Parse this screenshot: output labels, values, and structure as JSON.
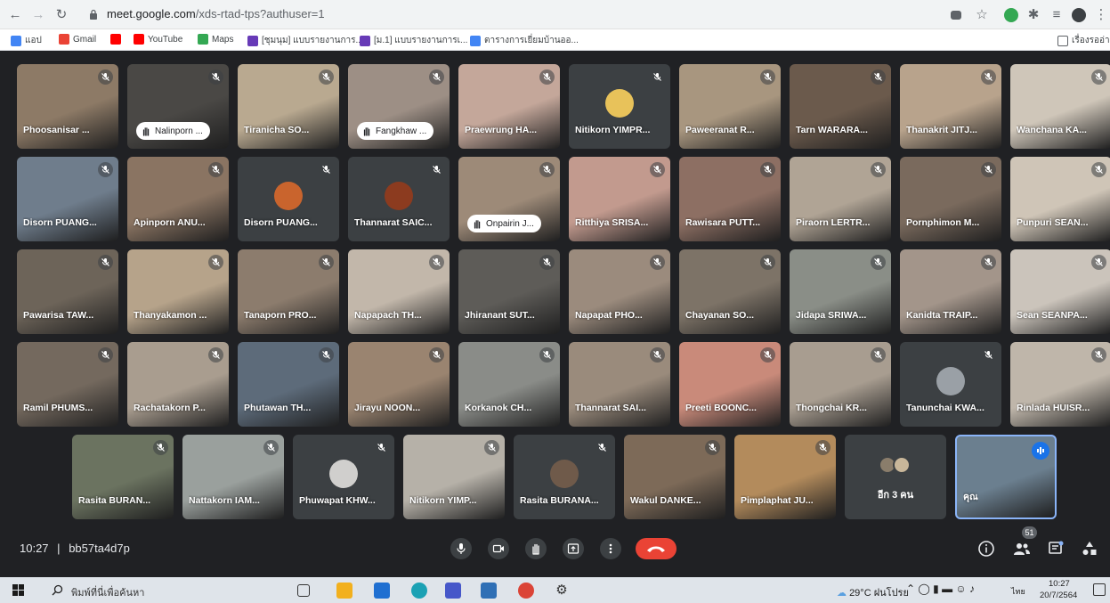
{
  "browser": {
    "url_host": "meet.google.com",
    "url_path": "/xds-rtad-tps?authuser=1",
    "bookmarks": [
      {
        "label": "แอป",
        "color": "#4285f4"
      },
      {
        "label": "Gmail",
        "color": "#ea4335"
      },
      {
        "label": "",
        "color": "#ff0000"
      },
      {
        "label": "YouTube",
        "color": "#ff0000"
      },
      {
        "label": "Maps",
        "color": "#34a853"
      },
      {
        "label": "[ชุมนุม] แบบรายงานการ...",
        "color": "#673ab7"
      },
      {
        "label": "[ม.1] แบบรายงานการเ...",
        "color": "#673ab7"
      },
      {
        "label": "ตารางการเยี่ยมบ้านออ...",
        "color": "#4285f4"
      }
    ],
    "reading_list": "เรื่องรออ่าน"
  },
  "participants": [
    {
      "name": "Phoosanisar ...",
      "bg": "#8d7a66",
      "type": "video"
    },
    {
      "name": "Nalinporn ...",
      "bg": "#4a4845",
      "type": "video",
      "hand": true
    },
    {
      "name": "Tiranicha SO...",
      "bg": "#b9a990",
      "type": "video"
    },
    {
      "name": "Fangkhaw ...",
      "bg": "#9d8f85",
      "type": "video",
      "hand": true
    },
    {
      "name": "Praewrung HA...",
      "bg": "#c4a79a",
      "type": "video"
    },
    {
      "name": "Nitikorn YIMPR...",
      "bg": "#3c4043",
      "type": "avatar",
      "avatar_color": "#e8c25a"
    },
    {
      "name": "Paweeranat R...",
      "bg": "#a8967f",
      "type": "video"
    },
    {
      "name": "Tarn WARARA...",
      "bg": "#6b5a4c",
      "type": "video"
    },
    {
      "name": "Thanakrit JITJ...",
      "bg": "#b8a38c",
      "type": "video"
    },
    {
      "name": "Wanchana KA...",
      "bg": "#cfc6b9",
      "type": "video"
    },
    {
      "name": "Disorn PUANG...",
      "bg": "#6f7d8c",
      "type": "video"
    },
    {
      "name": "Apinporn ANU...",
      "bg": "#8a7462",
      "type": "video"
    },
    {
      "name": "Disorn PUANG...",
      "bg": "#3c4043",
      "type": "avatar",
      "avatar_color": "#c9642d"
    },
    {
      "name": "Thannarat SAIC...",
      "bg": "#3c4043",
      "type": "avatar",
      "avatar_color": "#8c3b1f"
    },
    {
      "name": "Onpairin J...",
      "bg": "#9d8a78",
      "type": "video",
      "hand": true
    },
    {
      "name": "Ritthiya SRISA...",
      "bg": "#c29a8e",
      "type": "video"
    },
    {
      "name": "Rawisara PUTT...",
      "bg": "#8d6f63",
      "type": "video"
    },
    {
      "name": "Piraorn LERTR...",
      "bg": "#b0a495",
      "type": "video"
    },
    {
      "name": "Pornphimon M...",
      "bg": "#7a6a5d",
      "type": "video"
    },
    {
      "name": "Punpuri SEAN...",
      "bg": "#cfc5b7",
      "type": "video"
    },
    {
      "name": "Pawarisa TAW...",
      "bg": "#6d6459",
      "type": "video"
    },
    {
      "name": "Thanyakamon ...",
      "bg": "#b6a38a",
      "type": "video"
    },
    {
      "name": "Tanaporn PRO...",
      "bg": "#8c7c6d",
      "type": "video"
    },
    {
      "name": "Napapach TH...",
      "bg": "#c2b7aa",
      "type": "video"
    },
    {
      "name": "Jhiranant SUT...",
      "bg": "#5e5c58",
      "type": "video"
    },
    {
      "name": "Napapat PHO...",
      "bg": "#9b8b7d",
      "type": "video"
    },
    {
      "name": "Chayanan SO...",
      "bg": "#7d7367",
      "type": "video"
    },
    {
      "name": "Jidapa SRIWA...",
      "bg": "#8a8e87",
      "type": "video"
    },
    {
      "name": "Kanidta TRAIP...",
      "bg": "#a3958a",
      "type": "video"
    },
    {
      "name": "Sean SEANPA...",
      "bg": "#cbc4bb",
      "type": "video"
    },
    {
      "name": "Ramil PHUMS...",
      "bg": "#74695e",
      "type": "video"
    },
    {
      "name": "Rachatakorn P...",
      "bg": "#a99d8f",
      "type": "video"
    },
    {
      "name": "Phutawan TH...",
      "bg": "#5d6b7a",
      "type": "video"
    },
    {
      "name": "Jirayu NOON...",
      "bg": "#9a8470",
      "type": "video"
    },
    {
      "name": "Korkanok CH...",
      "bg": "#8a8c88",
      "type": "video"
    },
    {
      "name": "Thannarat SAI...",
      "bg": "#9a8b7c",
      "type": "video"
    },
    {
      "name": "Preeti BOONC...",
      "bg": "#c98a7a",
      "type": "video"
    },
    {
      "name": "Thongchai KR...",
      "bg": "#a89d90",
      "type": "video"
    },
    {
      "name": "Tanunchai KWA...",
      "bg": "#3c4043",
      "type": "avatar",
      "avatar_color": "#9aa0a6"
    },
    {
      "name": "Rinlada HUISR...",
      "bg": "#bfb6aa",
      "type": "video"
    },
    {
      "name": "Rasita BURAN...",
      "bg": "#6b7360",
      "type": "video"
    },
    {
      "name": "Nattakorn IAM...",
      "bg": "#9aa09d",
      "type": "video"
    },
    {
      "name": "Phuwapat KHW...",
      "bg": "#3c4043",
      "type": "avatar",
      "avatar_color": "#d0cfcd"
    },
    {
      "name": "Nitikorn YIMP...",
      "bg": "#b6b1a8",
      "type": "video"
    },
    {
      "name": "Rasita BURANA...",
      "bg": "#3c4043",
      "type": "avatar",
      "avatar_color": "#6f5a4a"
    },
    {
      "name": "Wakul DANKE...",
      "bg": "#7d6a58",
      "type": "video"
    },
    {
      "name": "Pimplaphat JU...",
      "bg": "#b38b5c",
      "type": "video"
    },
    {
      "name": "",
      "bg": "#3c4043",
      "type": "more",
      "more_label": "อีก 3 คน"
    },
    {
      "name": "คุณ",
      "bg": "#6b7f8f",
      "type": "self"
    }
  ],
  "meeting": {
    "time": "10:27",
    "separator": "|",
    "code": "bb57ta4d7p",
    "participant_count": "51"
  },
  "taskbar": {
    "search_placeholder": "พิมพ์ที่นี่เพื่อค้นหา",
    "weather": "29°C ฝนโปรย",
    "language": "ไทย",
    "clock_time": "10:27",
    "clock_date": "20/7/2564"
  },
  "colors": {
    "end_call": "#ea4335",
    "self_border": "#8ab4f8",
    "meet_bg": "#202124"
  }
}
